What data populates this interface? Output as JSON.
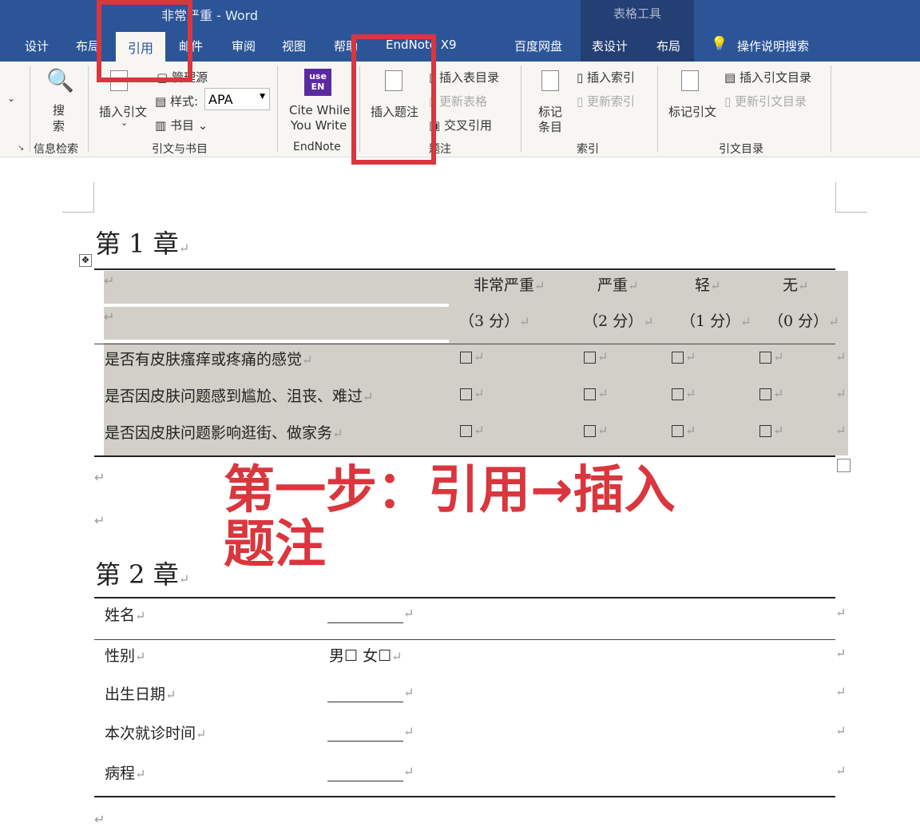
{
  "window": {
    "title": "非常严重  -  Word",
    "table_tools": "表格工具"
  },
  "tabs": [
    "设计",
    "布局",
    "引用",
    "邮件",
    "审阅",
    "视图",
    "帮助",
    "EndNote X9",
    "百度网盘",
    "表设计",
    "布局"
  ],
  "search_hint": "操作说明搜索",
  "ribbon": {
    "search_btn": "搜\n索",
    "search_group": "信息检索",
    "insert_citation": "插入引文",
    "manage_sources": "管理源",
    "style_label": "样式:",
    "style_value": "APA",
    "bibliography": "书目",
    "citations_group": "引文与书目",
    "cite_while_1": "Cite While",
    "cite_while_2": "You Write",
    "endnote_group": "EndNote",
    "endnote_icon": "use EN",
    "insert_caption": "插入题注",
    "insert_tof": "插入表目录",
    "update_table": "更新表格",
    "cross_ref": "交叉引用",
    "captions_group": "题注",
    "mark_entry_1": "标记",
    "mark_entry_2": "条目",
    "insert_index": "插入索引",
    "update_index": "更新索引",
    "index_group": "索引",
    "mark_citation": "标记引文",
    "insert_toa": "插入引文目录",
    "update_toa": "更新引文目录",
    "toa_group": "引文目录"
  },
  "doc": {
    "ch1": "第 1 章",
    "ch2": "第 2 章",
    "t1_headers": [
      "非常严重",
      "严重",
      "轻",
      "无"
    ],
    "t1_scores": [
      "（3 分）",
      "（2 分）",
      "（1 分）",
      "（0 分）"
    ],
    "t1_rows": [
      "是否有皮肤瘙痒或疼痛的感觉",
      "是否因皮肤问题感到尴尬、沮丧、难过",
      "是否因皮肤问题影响逛街、做家务"
    ],
    "t2_rows": [
      "姓名",
      "性别",
      "出生日期",
      "本次就诊时间",
      "病程"
    ],
    "gender": "男☐  女☐",
    "return_mark": "↵"
  },
  "annotation": "第一步：引用→插入题注",
  "colors": {
    "title_blue": "#2c5597",
    "annotation_red": "#d9363e",
    "table_shade": "#d1cfc8"
  }
}
